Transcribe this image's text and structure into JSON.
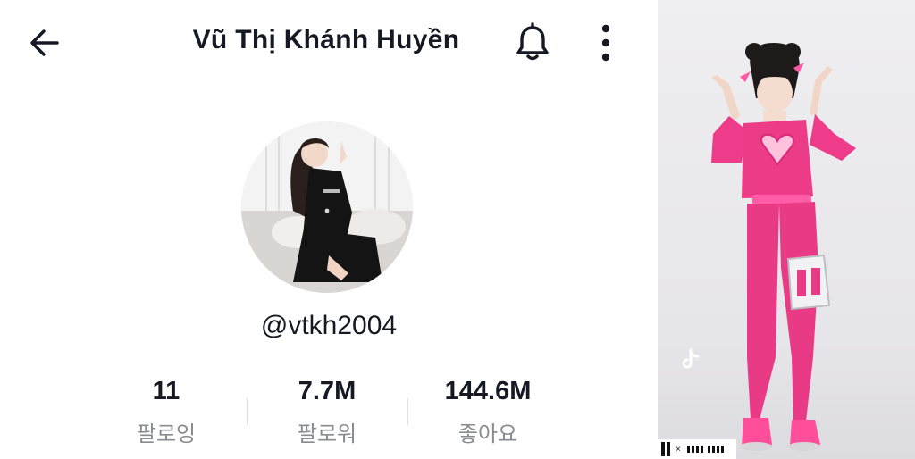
{
  "header": {
    "title": "Vũ Thị Khánh Huyền",
    "icons": {
      "back": "arrow-left-icon",
      "notify": "bell-icon",
      "more": "more-vertical-icon"
    }
  },
  "profile": {
    "username": "@vtkh2004",
    "stats": [
      {
        "value": "11",
        "label": "팔로잉"
      },
      {
        "value": "7.7M",
        "label": "팔로워"
      },
      {
        "value": "144.6M",
        "label": "좋아요"
      }
    ]
  },
  "video": {
    "watermark": {
      "logo": "tiktok-logo-icon"
    },
    "brand": {
      "x": "×"
    }
  }
}
